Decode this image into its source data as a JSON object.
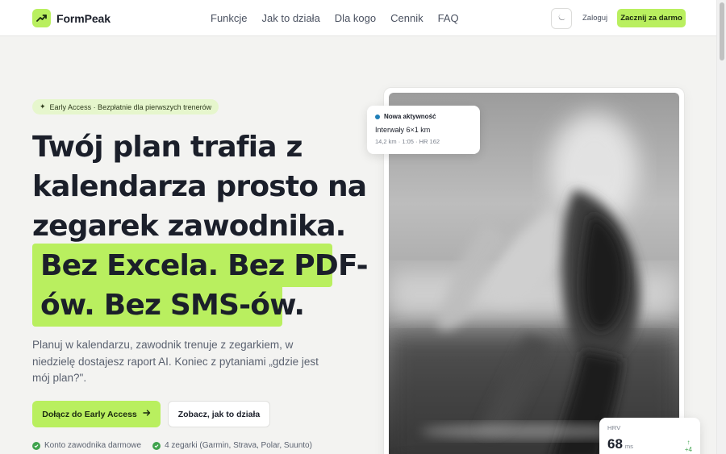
{
  "brand": {
    "name": "FormPeak",
    "accent": "#b9ef5f"
  },
  "nav": {
    "items": [
      {
        "label": "Funkcje"
      },
      {
        "label": "Jak to działa"
      },
      {
        "label": "Dla kogo"
      },
      {
        "label": "Cennik"
      },
      {
        "label": "FAQ"
      }
    ],
    "theme_icon": "moon-icon",
    "login_label": "Zaloguj",
    "cta_label": "Zacznij za darmo"
  },
  "hero": {
    "badge": "Early Access · Bezpłatnie dla pierwszych trenerów",
    "headline_lines": [
      "Twój plan trafia z",
      "kalendarza prosto na",
      "zegarek zawodnika."
    ],
    "highlight_lines": [
      "Bez Excela. Bez PDF-",
      "ów. Bez SMS-ów."
    ],
    "subtitle": "Planuj w kalendarzu, zawodnik trenuje z zegarkiem, w niedzielę dostajesz raport AI. Koniec z pytaniami „gdzie jest mój plan?\".",
    "primary_button": "Dołącz do Early Access",
    "primary_icon": "arrow-right-icon",
    "secondary_button": "Zobacz, jak to działa",
    "checks": [
      "Konto zawodnika darmowe",
      "4 zegarki (Garmin, Strava, Polar, Suunto)"
    ]
  },
  "notification": {
    "title": "Nowa aktywność",
    "activity": "Interwały 6×1 km",
    "meta": "14,2 km · 1:05 · HR 162",
    "dot_color": "#1f7fb8"
  },
  "hrv_card": {
    "label": "HRV",
    "value": "68",
    "unit": "ms",
    "delta": "+4",
    "delta_color": "#3fa34d"
  }
}
